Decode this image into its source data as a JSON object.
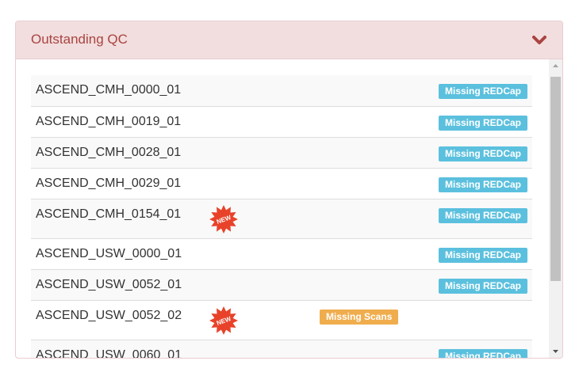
{
  "panel": {
    "title": "Outstanding QC",
    "toggle_icon": "chevron-down-icon",
    "accent_color": "#a94442"
  },
  "items": [
    {
      "label": "ASCEND_CMH_0000_01",
      "status": "Missing REDCap",
      "status_type": "info",
      "is_new": false
    },
    {
      "label": "ASCEND_CMH_0019_01",
      "status": "Missing REDCap",
      "status_type": "info",
      "is_new": false
    },
    {
      "label": "ASCEND_CMH_0028_01",
      "status": "Missing REDCap",
      "status_type": "info",
      "is_new": false
    },
    {
      "label": "ASCEND_CMH_0029_01",
      "status": "Missing REDCap",
      "status_type": "info",
      "is_new": false
    },
    {
      "label": "ASCEND_CMH_0154_01",
      "status": "Missing REDCap",
      "status_type": "info",
      "is_new": true,
      "new_text": "NEW"
    },
    {
      "label": "ASCEND_USW_0000_01",
      "status": "Missing REDCap",
      "status_type": "info",
      "is_new": false
    },
    {
      "label": "ASCEND_USW_0052_01",
      "status": "Missing REDCap",
      "status_type": "info",
      "is_new": false
    },
    {
      "label": "ASCEND_USW_0052_02",
      "status": "Missing Scans",
      "status_type": "warn",
      "is_new": true,
      "new_text": "NEW"
    },
    {
      "label": "ASCEND_USW_0060_01",
      "status": "Missing REDCap",
      "status_type": "info",
      "is_new": false
    }
  ],
  "colors": {
    "info_badge": "#5bc0de",
    "warn_badge": "#f0ad4e",
    "new_star": "#e8432a"
  }
}
